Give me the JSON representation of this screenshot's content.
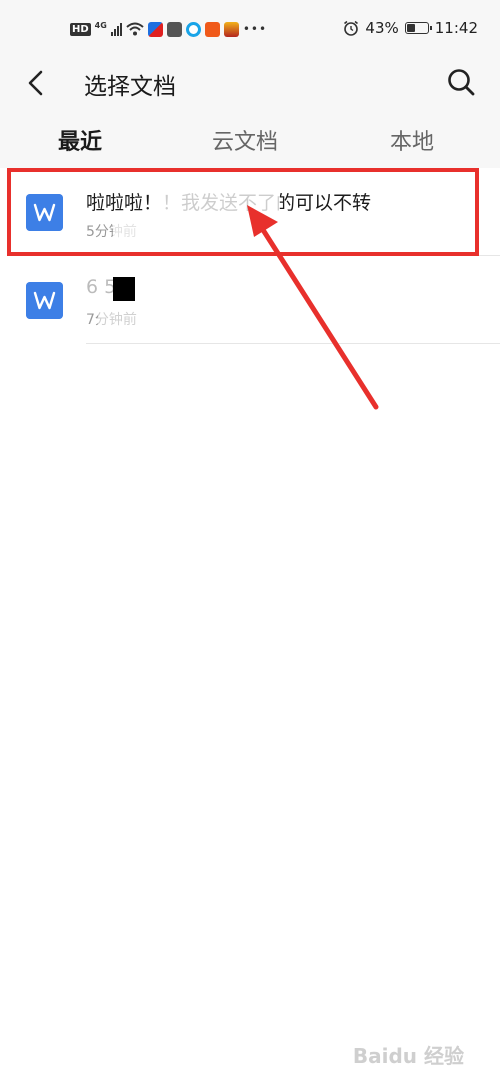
{
  "status_bar": {
    "hd": "HD",
    "network": "4G",
    "alarm_icon": "alarm-clock-icon",
    "battery": "43%",
    "battery_level": 0.43,
    "time": "11:42"
  },
  "header": {
    "back_icon": "chevron-left-icon",
    "title": "选择文档",
    "search_icon": "search-icon"
  },
  "tabs": [
    {
      "label": "最近",
      "active": true
    },
    {
      "label": "云文档",
      "active": false
    },
    {
      "label": "本地",
      "active": false
    }
  ],
  "documents": [
    {
      "name": "啦啦啦！！我发送不了的可以不转",
      "time": "5分钟前",
      "icon": "word-doc-icon"
    },
    {
      "name": "6  5",
      "time": "7分钟前",
      "icon": "word-doc-icon"
    }
  ],
  "watermark": "Baidu 经验",
  "colors": {
    "accent_blue": "#3d7fe6",
    "annotation_red": "#e8302c",
    "header_bg": "#f7f7f7"
  }
}
